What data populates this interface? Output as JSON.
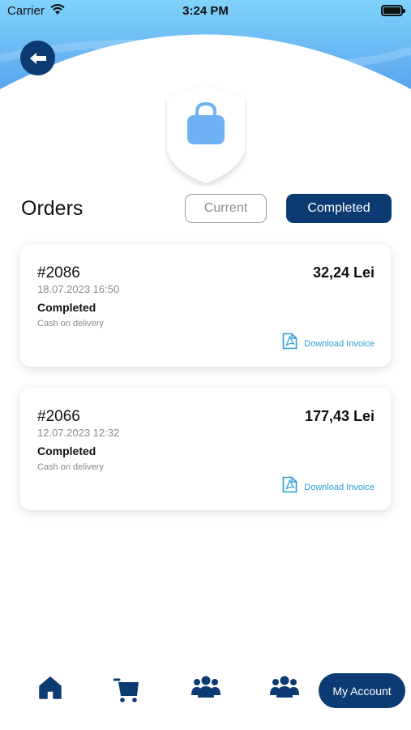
{
  "status_bar": {
    "carrier": "Carrier",
    "time": "3:24 PM"
  },
  "header": {
    "title": "Orders",
    "shield_icon": "shopping-bag-icon",
    "back_icon": "back-arrow-icon"
  },
  "tabs": [
    {
      "label": "Current",
      "selected": false
    },
    {
      "label": "Completed",
      "selected": true
    }
  ],
  "orders": [
    {
      "id": "#2086",
      "date": "18.07.2023  16:50",
      "total": "32,24 Lei",
      "status": "Completed",
      "payment": "Cash on delivery",
      "invoice_label": "Download Invoice"
    },
    {
      "id": "#2066",
      "date": "12.07.2023  12:32",
      "total": "177,43 Lei",
      "status": "Completed",
      "payment": "Cash on delivery",
      "invoice_label": "Download Invoice"
    }
  ],
  "bottom_nav": {
    "items": [
      {
        "icon": "home-icon"
      },
      {
        "icon": "cart-icon"
      },
      {
        "icon": "users-group-icon"
      },
      {
        "icon": "users-group-icon"
      }
    ],
    "account_label": "My Account"
  },
  "colors": {
    "primary": "#0c3b73",
    "header_gradient_top": "#7fd3fb",
    "header_gradient_bottom": "#5aa4ee",
    "link": "#2aa0d6",
    "bag_icon": "#6fb2f3"
  }
}
